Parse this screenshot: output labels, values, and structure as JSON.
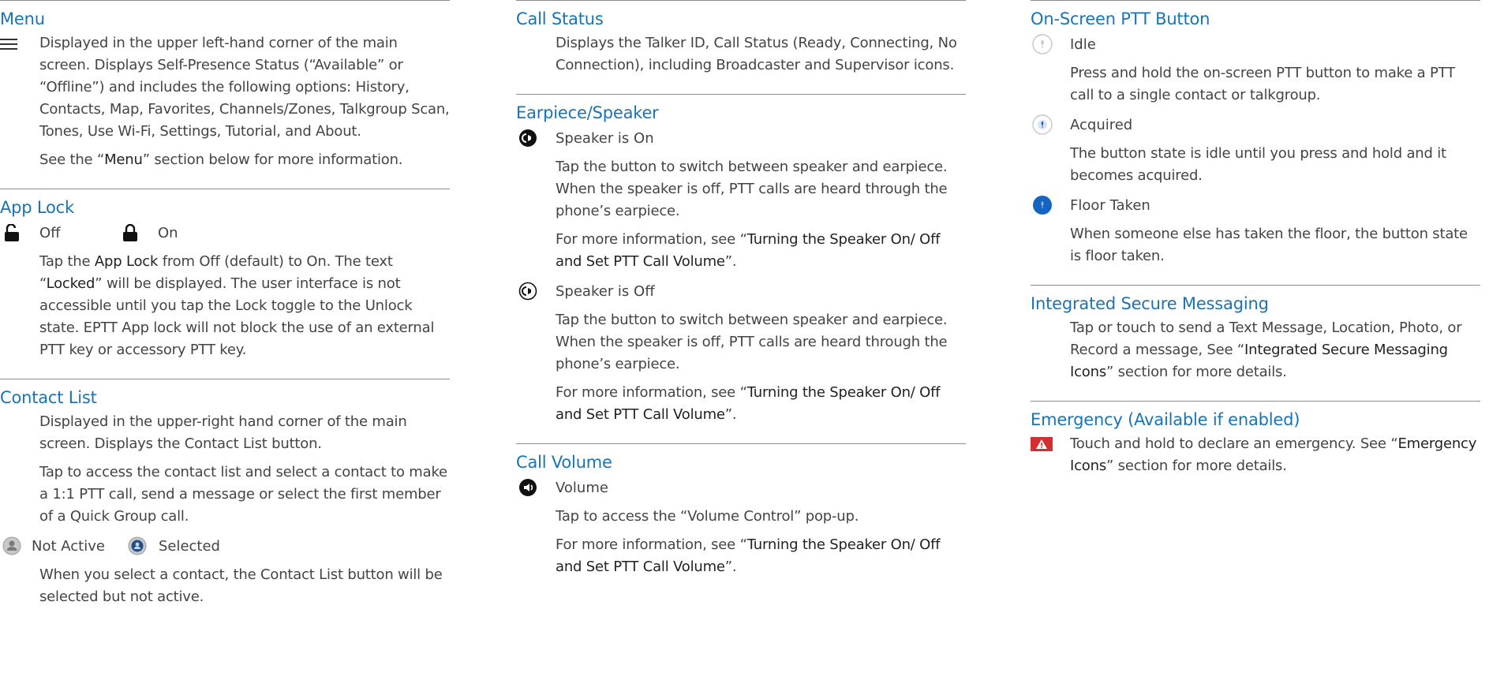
{
  "col1": {
    "menu": {
      "title": "Menu",
      "icon": "hamburger-icon",
      "desc": "Displayed in the upper left-hand corner of the main screen. Displays Self-Presence Status (“Available” or “Offline”) and includes the following options: History, Contacts, Map, Favorites, Channels/Zones, Talkgroup Scan, Tones, Use Wi-Fi, Settings, Tutorial, and About.",
      "see_pre": "See the “",
      "see_link": "Menu",
      "see_post": "” section below for more information."
    },
    "app_lock": {
      "title": "App Lock",
      "off_label": "Off",
      "on_label": "On",
      "desc_pre": "Tap the ",
      "desc_bold": "App Lock",
      "desc_mid": " from Off (default) to On. The text “",
      "desc_bold2": "Locked",
      "desc_post": "” will be displayed. The user interface is not accessible until you tap the Lock toggle to the Unlock state. EPTT App lock will not block the use of an external PTT key or accessory PTT key."
    },
    "contact_list": {
      "title": "Contact List",
      "desc1": "Displayed in the upper-right hand corner of the main screen. Displays the Contact List button.",
      "desc2": "Tap to access the contact list and select a contact to make a 1:1 PTT call, send a message or select the first member of a Quick Group call.",
      "not_active": "Not Active",
      "selected": "Selected",
      "desc3": "When you select a contact, the Contact List button will be selected but not active."
    }
  },
  "col2": {
    "call_status": {
      "title": "Call Status",
      "desc": "Displays the Talker ID, Call Status (Ready, Connecting, No Connection), including Broadcaster and Supervisor icons."
    },
    "earpiece": {
      "title": "Earpiece/Speaker",
      "on_label": "Speaker is On",
      "on_desc": "Tap the button to switch between speaker and earpiece. When the speaker is off, PTT calls are heard through the phone’s earpiece.",
      "more_pre": "For more information, see “",
      "more_link": "Turning the Speaker On/ Off and Set PTT Call Volume",
      "more_post": "”.",
      "off_label": "Speaker is Off",
      "off_desc": "Tap the button to switch between speaker and earpiece. When the speaker is off, PTT calls are heard through the phone’s earpiece."
    },
    "call_volume": {
      "title": "Call Volume",
      "label": "Volume",
      "desc": "Tap to access the “Volume Control” pop-up.",
      "more_pre": "For more information, see “",
      "more_link": "Turning the Speaker On/ Off and Set PTT Call Volume",
      "more_post": "”."
    }
  },
  "col3": {
    "ptt": {
      "title": "On-Screen PTT Button",
      "idle": "Idle",
      "idle_desc": "Press and hold the on-screen PTT button to make a PTT call to a single contact or talkgroup.",
      "acquired": "Acquired",
      "acquired_desc": "The button state is idle until you press and hold and it becomes acquired.",
      "floor": "Floor Taken",
      "floor_desc": "When someone else has taken the floor, the button state is floor taken."
    },
    "ism": {
      "title": "Integrated Secure Messaging",
      "desc_pre": "Tap or touch to send a Text Message, Location, Photo, or Record a message, See “",
      "desc_link": "Integrated Secure Messaging Icons",
      "desc_post": "” section for more details."
    },
    "emergency": {
      "title": "Emergency (Available if enabled)",
      "desc_pre": "Touch and hold to declare an emergency. See “",
      "desc_link": "Emergency Icons",
      "desc_post": "” section for more details."
    }
  },
  "colors": {
    "heading": "#1a73b5",
    "text": "#444444",
    "rule": "#8c8c8c",
    "emergency": "#d32f2f",
    "ptt_blue": "#1565c0"
  }
}
